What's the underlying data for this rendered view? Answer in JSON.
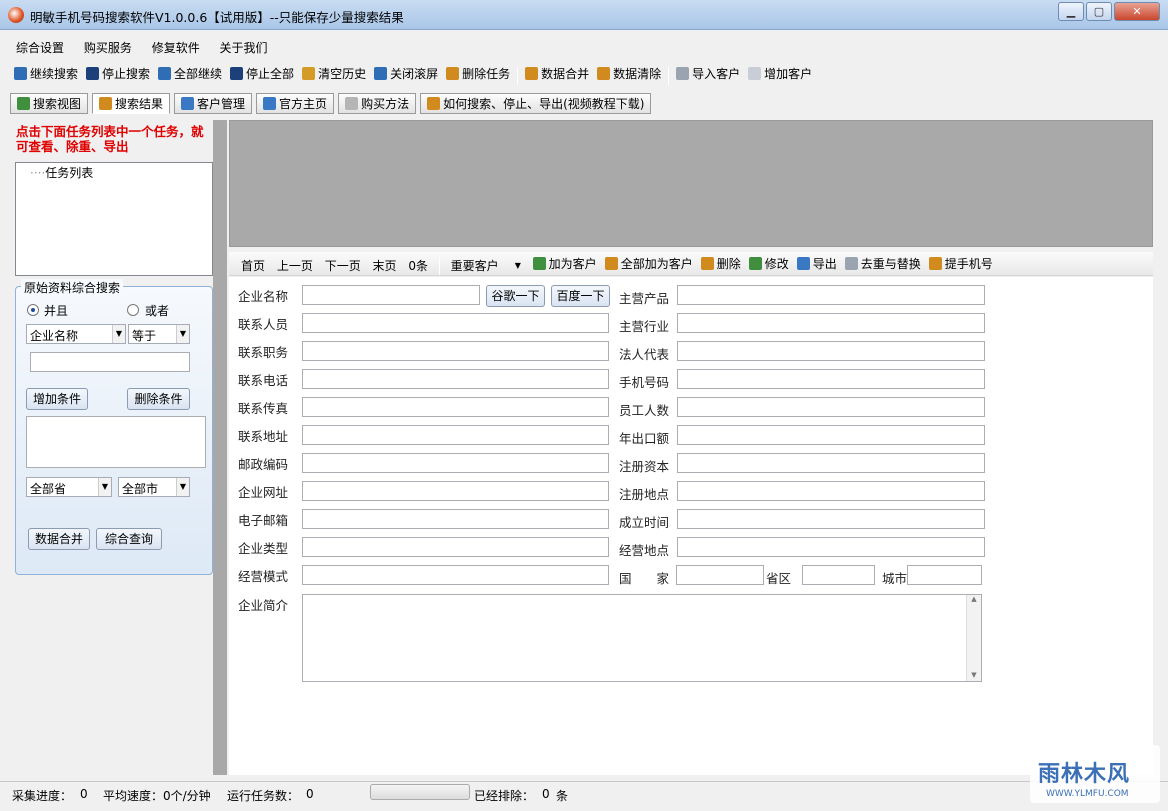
{
  "window": {
    "title": "明敏手机号码搜索软件V1.0.0.6【试用版】--只能保存少量搜索结果",
    "min": "▁",
    "max": "▢",
    "close": "✕"
  },
  "menu": [
    "综合设置",
    "购买服务",
    "修复软件",
    "关于我们"
  ],
  "toolbar": [
    {
      "label": "继续搜索",
      "icon": "play-icon",
      "color": "#2f6db5"
    },
    {
      "label": "停止搜索",
      "icon": "stop-icon",
      "color": "#1d3f7a"
    },
    {
      "label": "全部继续",
      "icon": "play-all-icon",
      "color": "#2f6db5"
    },
    {
      "label": "停止全部",
      "icon": "stop-all-icon",
      "color": "#1d3f7a"
    },
    {
      "label": "清空历史",
      "icon": "clear-history-icon",
      "color": "#d59b27"
    },
    {
      "label": "关闭滚屏",
      "icon": "arrow-down-icon",
      "color": "#2f6db5"
    },
    {
      "label": "删除任务",
      "icon": "delete-task-icon",
      "color": "#d08a1e"
    },
    {
      "label": "数据合并",
      "icon": "merge-data-icon",
      "color": "#d08a1e"
    },
    {
      "label": "数据清除",
      "icon": "clean-data-icon",
      "color": "#d08a1e"
    },
    {
      "label": "导入客户",
      "icon": "import-customer-icon",
      "color": "#9aa4b0"
    },
    {
      "label": "增加客户",
      "icon": "add-customer-icon",
      "color": "#c9ced6"
    }
  ],
  "tabs": [
    {
      "label": "搜索视图",
      "icon": "refresh-icon",
      "color": "#3f8f3f"
    },
    {
      "label": "搜索结果",
      "icon": "results-icon",
      "color": "#d08a1e"
    },
    {
      "label": "客户管理",
      "icon": "folder-icon",
      "color": "#3b78c4"
    },
    {
      "label": "官方主页",
      "icon": "folder-icon",
      "color": "#3b78c4"
    },
    {
      "label": "购买方法",
      "icon": "pencil-icon",
      "color": "#b5b5b5"
    },
    {
      "label": "如何搜索、停止、导出(视频教程下载)",
      "icon": "video-icon",
      "color": "#d08a1e"
    }
  ],
  "left": {
    "hint": "点击下面任务列表中一个任务，就可查看、除重、导出",
    "tree_root": "任务列表",
    "group_title": "原始资料综合搜索",
    "radio_and": "并且",
    "radio_or": "或者",
    "field_combo": "企业名称",
    "op_combo": "等于",
    "add_condition": "增加条件",
    "delete_condition": "删除条件",
    "province": "全部省",
    "city": "全部市",
    "merge": "数据合并",
    "query": "综合查询"
  },
  "grid_toolbar": {
    "first": "首页",
    "prev": "上一页",
    "next": "下一页",
    "last": "末页",
    "count": "0条",
    "important": "重要客户",
    "actions": [
      {
        "label": "加为客户",
        "icon": "add-customer-icon",
        "color": "#3f8f3f"
      },
      {
        "label": "全部加为客户",
        "icon": "add-all-icon",
        "color": "#d08a1e"
      },
      {
        "label": "删除",
        "icon": "delete-icon",
        "color": "#d08a1e"
      },
      {
        "label": "修改",
        "icon": "edit-icon",
        "color": "#3f8f3f"
      },
      {
        "label": "导出",
        "icon": "export-icon",
        "color": "#3b78c4"
      },
      {
        "label": "去重与替换",
        "icon": "dedupe-icon",
        "color": "#9aa4b0"
      },
      {
        "label": "提手机号",
        "icon": "phone-extract-icon",
        "color": "#d08a1e"
      }
    ]
  },
  "form": {
    "company_name": "企业名称",
    "google": "谷歌一下",
    "baidu": "百度一下",
    "contact": "联系人员",
    "position": "联系职务",
    "phone": "联系电话",
    "fax": "联系传真",
    "address": "联系地址",
    "postcode": "邮政编码",
    "website": "企业网址",
    "email": "电子邮箱",
    "type": "企业类型",
    "mode": "经营模式",
    "intro": "企业简介",
    "product": "主营产品",
    "industry": "主营行业",
    "legal": "法人代表",
    "mobile": "手机号码",
    "staff": "员工人数",
    "export": "年出口额",
    "capital": "注册资本",
    "reg_place": "注册地点",
    "founded": "成立时间",
    "biz_place": "经营地点",
    "country": "国　　家",
    "province": "省区",
    "city": "城市"
  },
  "status": {
    "progress_label": "采集进度：",
    "progress_val": "0",
    "speed_label": "平均速度：",
    "speed_val": "0个/分钟",
    "tasks_label": "运行任务数：",
    "tasks_val": "0",
    "excluded_label": "已经排除：",
    "excluded_val": "0",
    "excluded_unit": "条"
  },
  "watermark": {
    "main": "雨林木风",
    "sub": "WWW.YLMFU.COM"
  }
}
